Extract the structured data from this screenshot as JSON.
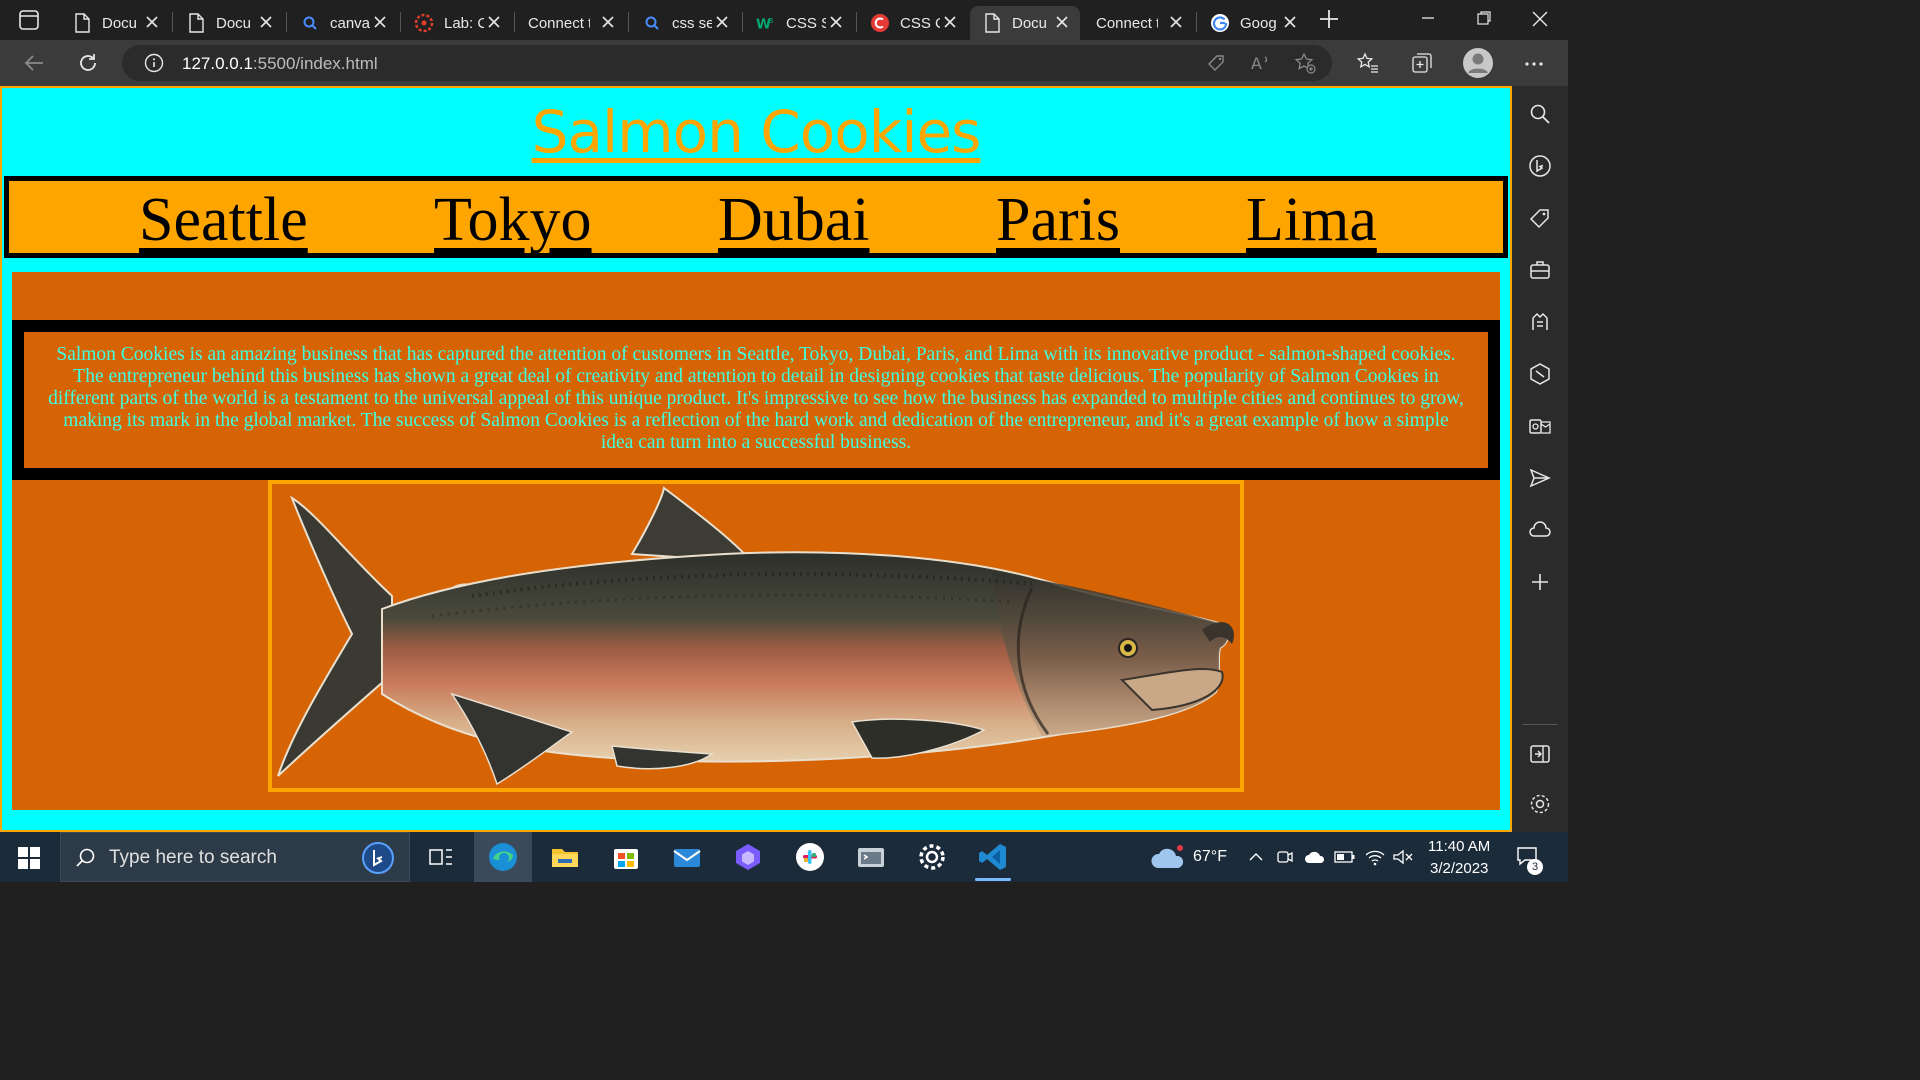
{
  "browser": {
    "tabs": [
      {
        "title": "Docu",
        "icon": "page-icon"
      },
      {
        "title": "Docu",
        "icon": "page-icon"
      },
      {
        "title": "canva",
        "icon": "search-icon"
      },
      {
        "title": "Lab: C",
        "icon": "canvas-icon"
      },
      {
        "title": "Connect to",
        "icon": "none"
      },
      {
        "title": "css se",
        "icon": "search-icon"
      },
      {
        "title": "CSS S",
        "icon": "w3-icon"
      },
      {
        "title": "CSS C",
        "icon": "codecademy-icon"
      },
      {
        "title": "Docu",
        "icon": "page-icon",
        "active": true
      },
      {
        "title": "Connect to",
        "icon": "none"
      },
      {
        "title": "Goog",
        "icon": "google-icon"
      }
    ],
    "url_host": "127.0.0.1",
    "url_rest": ":5500/index.html"
  },
  "page": {
    "title": "Salmon Cookies",
    "nav": [
      "Seattle",
      "Tokyo",
      "Dubai",
      "Paris",
      "Lima"
    ],
    "about": "Salmon Cookies is an amazing business that has captured the attention of customers in Seattle, Tokyo, Dubai, Paris, and Lima with its innovative product - salmon-shaped cookies. The entrepreneur behind this business has shown a great deal of creativity and attention to detail in designing cookies that taste delicious. The popularity of Salmon Cookies in different parts of the world is a testament to the universal appeal of this unique product. It's impressive to see how the business has expanded to multiple cities and continues to grow, making its mark in the global market. The success of Salmon Cookies is a reflection of the hard work and dedication of the entrepreneur, and it's a great example of how a simple idea can turn into a successful business."
  },
  "taskbar": {
    "search_placeholder": "Type here to search",
    "weather": "67°F",
    "time": "11:40 AM",
    "date": "3/2/2023",
    "notifications": "3"
  },
  "colors": {
    "page_bg": "#00ffff",
    "nav_bg": "#ffa500",
    "main_bg": "#d66304",
    "about_text": "#40ffe0"
  }
}
